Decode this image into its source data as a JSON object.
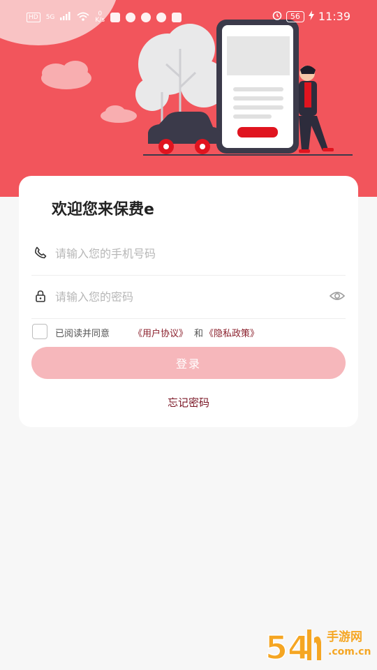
{
  "status_bar": {
    "hd": "HD",
    "network": "5G",
    "speed_value": "0",
    "speed_unit": "K/s",
    "battery": "56",
    "time": "11:39"
  },
  "welcome_title": "欢迎您来保费e",
  "phone_field": {
    "placeholder": "请输入您的手机号码",
    "icon": "phone-icon"
  },
  "password_field": {
    "placeholder": "请输入您的密码",
    "icon": "lock-icon",
    "visibility_icon": "eye-icon"
  },
  "agreement": {
    "prefix": "已阅读并同意",
    "user_agreement": "《用户协议》",
    "and": "和",
    "privacy_policy": "《隐私政策》",
    "checked": false
  },
  "login_button": "登录",
  "forgot_password": "忘记密码",
  "watermark": {
    "big": "54",
    "small": "手游网",
    "domain": ".com.cn"
  },
  "colors": {
    "brand": "#f2555c",
    "button_disabled": "#f6b7bb",
    "link": "#8a1f2b"
  }
}
